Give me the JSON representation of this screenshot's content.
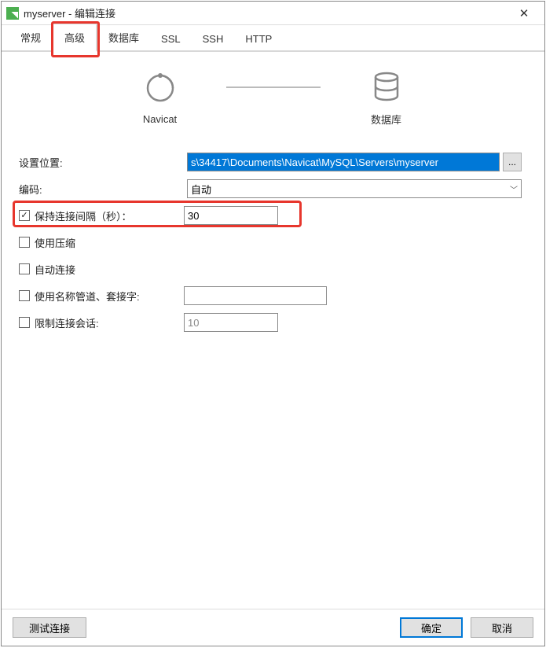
{
  "window": {
    "title": "myserver - 编辑连接"
  },
  "tabs": {
    "items": [
      "常规",
      "高级",
      "数据库",
      "SSL",
      "SSH",
      "HTTP"
    ],
    "active_index": 1
  },
  "diagram": {
    "left_label": "Navicat",
    "right_label": "数据库"
  },
  "form": {
    "location_label": "设置位置:",
    "location_value": "s\\34417\\Documents\\Navicat\\MySQL\\Servers\\myserver",
    "browse_label": "...",
    "encoding_label": "编码:",
    "encoding_value": "自动",
    "keepalive_checked": true,
    "keepalive_label": "保持连接间隔（秒）：",
    "keepalive_value": "30",
    "compress_checked": false,
    "compress_label": "使用压缩",
    "autoconn_checked": false,
    "autoconn_label": "自动连接",
    "pipe_checked": false,
    "pipe_label": "使用名称管道、套接字:",
    "pipe_value": "",
    "limit_checked": false,
    "limit_label": "限制连接会话:",
    "limit_value": "10"
  },
  "footer": {
    "test": "测试连接",
    "ok": "确定",
    "cancel": "取消"
  },
  "highlights": {
    "color": "#e7362d"
  }
}
